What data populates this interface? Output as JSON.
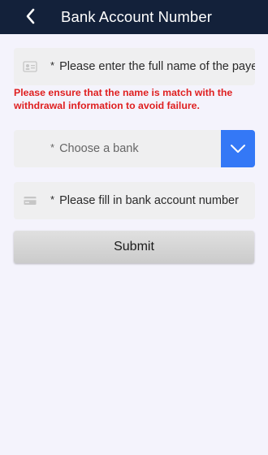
{
  "header": {
    "title": "Bank Account Number",
    "back_icon": "chevron-left-icon"
  },
  "name_field": {
    "required_mark": "*",
    "placeholder": "Please enter the full name of the payee",
    "icon": "id-card-icon"
  },
  "warning": {
    "text": "Please ensure that the name is match with the withdrawal information to avoid failure."
  },
  "bank_field": {
    "required_mark": "*",
    "placeholder": "Choose a bank",
    "dropdown_icon": "chevron-down-icon"
  },
  "account_field": {
    "required_mark": "*",
    "placeholder": "Please fill in bank account number",
    "icon": "credit-card-icon"
  },
  "submit": {
    "label": "Submit"
  },
  "colors": {
    "header_bg": "#13213a",
    "page_bg": "#f4f3fc",
    "warning_text": "#df1f20",
    "dropdown_bg": "#3478f6"
  }
}
